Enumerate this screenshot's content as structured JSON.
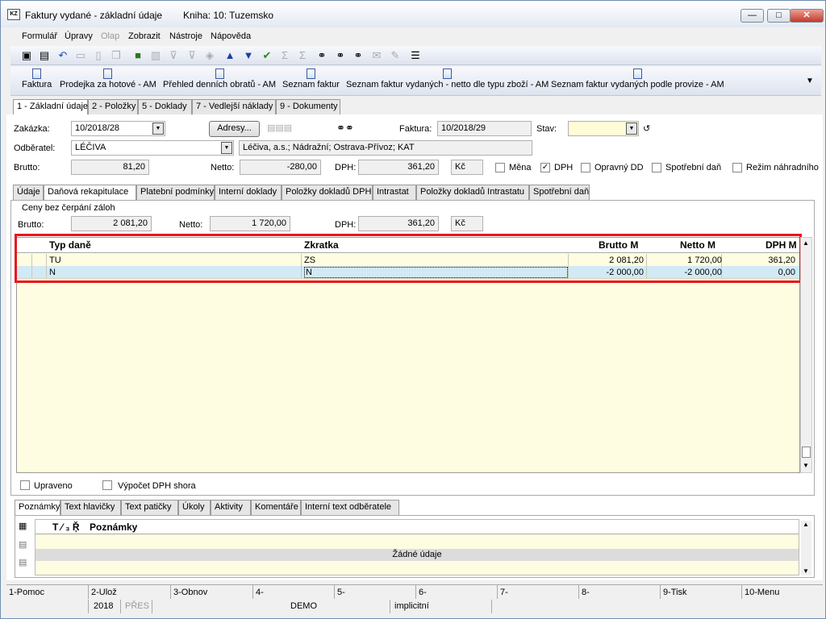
{
  "window": {
    "title": "Faktury vydané - základní údaje",
    "book": "Kniha: 10: Tuzemsko",
    "app_icon_text": "KZ"
  },
  "menu": [
    "Formulář",
    "Úpravy",
    "Olap",
    "Zobrazit",
    "Nástroje",
    "Nápověda"
  ],
  "reports": [
    "Faktura",
    "Prodejka za hotové - AM",
    "Přehled denních obratů - AM",
    "Seznam faktur",
    "Seznam faktur vydaných - netto dle typu zboží - AM",
    "Seznam faktur vydaných podle provize - AM"
  ],
  "main_tabs": [
    "1 - Základní údaje",
    "2 - Položky",
    "5 - Doklady",
    "7 - Vedlejší náklady",
    "9 - Dokumenty"
  ],
  "header": {
    "zakazka_label": "Zakázka:",
    "zakazka_value": "10/2018/28",
    "adresy_button": "Adresy...",
    "faktura_label": "Faktura:",
    "faktura_value": "10/2018/29",
    "stav_label": "Stav:",
    "stav_value": "",
    "odberatel_label": "Odběratel:",
    "odberatel_value": "LÉČIVA",
    "odberatel_address": "Léčiva, a.s.; Nádražní; Ostrava-Přívoz; KAT",
    "brutto_label": "Brutto:",
    "brutto_value": "81,20",
    "netto_label": "Netto:",
    "netto_value": "-280,00",
    "dph_label": "DPH:",
    "dph_value": "361,20",
    "currency": "Kč",
    "mena_label": "Měna",
    "dph_check_label": "DPH",
    "opravny_label": "Opravný DD",
    "spotrebni_label": "Spotřební daň",
    "rezim_label": "Režim náhradního"
  },
  "sub_tabs": [
    "Údaje",
    "Daňová rekapitulace",
    "Platební podmínky",
    "Interní doklady",
    "Položky dokladů DPH",
    "Intrastat",
    "Položky dokladů Intrastatu",
    "Spotřební daň"
  ],
  "recap": {
    "group_label": "Ceny bez čerpání záloh",
    "brutto_label": "Brutto:",
    "brutto_value": "2 081,20",
    "netto_label": "Netto:",
    "netto_value": "1 720,00",
    "dph_label": "DPH:",
    "dph_value": "361,20",
    "currency": "Kč"
  },
  "table": {
    "columns": [
      "Typ daně",
      "Zkratka",
      "Brutto M",
      "Netto M",
      "DPH M"
    ],
    "rows": [
      {
        "typ": "TU",
        "zkratka": "ZS",
        "brutto": "2 081,20",
        "netto": "1 720,00",
        "dph": "361,20"
      },
      {
        "typ": "N",
        "zkratka": "N",
        "brutto": "-2 000,00",
        "netto": "-2 000,00",
        "dph": "0,00"
      }
    ]
  },
  "checkboxes": {
    "upraveno": "Upraveno",
    "vypocet": "Výpočet DPH shora"
  },
  "notes_tabs": [
    "Poznámky",
    "Text hlavičky",
    "Text patičky",
    "Úkoly",
    "Aktivity",
    "Komentáře",
    "Interní text odběratele"
  ],
  "notes": {
    "header_col": "Poznámky",
    "header_prefix": "T ⁄ ₃ Ŗ̌",
    "empty": "Žádné údaje"
  },
  "fkeys": [
    "1-Pomoc",
    "2-Ulož",
    "3-Obnov",
    "4-",
    "5-",
    "6-",
    "7-",
    "8-",
    "9-Tisk",
    "10-Menu"
  ],
  "statusbar": {
    "year": "2018",
    "mode": "PŘES",
    "db": "DEMO",
    "profile": "implicitní"
  },
  "colors": {
    "highlight_border": "#e8141e",
    "grid_bg": "#fffde1",
    "selected_row": "#d2eaf6"
  }
}
